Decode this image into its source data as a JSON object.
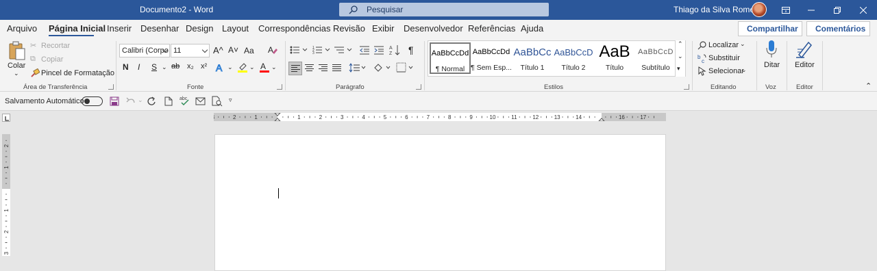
{
  "title_bar": {
    "document_title": "Documento2  -  Word",
    "search_placeholder": "Pesquisar",
    "user_name": "Thiago da Silva Romeiro"
  },
  "tabs": [
    "Arquivo",
    "Página Inicial",
    "Inserir",
    "Desenhar",
    "Design",
    "Layout",
    "Correspondências",
    "Revisão",
    "Exibir",
    "Desenvolvedor",
    "Referências",
    "Ajuda"
  ],
  "active_tab": "Página Inicial",
  "share": {
    "compartilhar": "Compartilhar",
    "comentarios": "Comentários"
  },
  "clipboard": {
    "paste": "Colar",
    "cut": "Recortar",
    "copy": "Copiar",
    "format_painter": "Pincel de Formatação",
    "group_label": "Área de Transferência"
  },
  "font": {
    "name": "Calibri (Corpo",
    "size": "11",
    "group_label": "Fonte",
    "grow": "A^",
    "shrink": "A˅",
    "case": "Aa",
    "bold": "N",
    "italic": "I",
    "underline": "S",
    "strike": "ab",
    "sub": "x₂",
    "sup": "x²"
  },
  "paragraph": {
    "group_label": "Parágrafo"
  },
  "styles": {
    "group_label": "Estilos",
    "items": [
      {
        "preview": "AaBbCcDd",
        "name": "¶ Normal"
      },
      {
        "preview": "AaBbCcDd",
        "name": "¶ Sem Esp..."
      },
      {
        "preview": "AaBbCc",
        "name": "Título 1"
      },
      {
        "preview": "AaBbCcD",
        "name": "Título 2"
      },
      {
        "preview": "AaB",
        "name": "Título"
      },
      {
        "preview": "AaBbCcD",
        "name": "Subtítulo"
      }
    ]
  },
  "editing": {
    "find": "Localizar",
    "replace": "Substituir",
    "select": "Selecionar",
    "group_label": "Editando"
  },
  "voice": {
    "dictate": "Ditar",
    "group_label": "Voz"
  },
  "editor": {
    "label": "Editor",
    "group_label": "Editor"
  },
  "qat": {
    "autosave": "Salvamento Automático"
  },
  "ruler": {
    "h_numbers": [
      "3",
      "2",
      "1",
      "1",
      "2",
      "3",
      "4",
      "5",
      "6",
      "7",
      "8",
      "9",
      "10",
      "11",
      "12",
      "13",
      "14",
      "16",
      "17"
    ],
    "v_numbers": [
      "2",
      "1",
      "1",
      "2",
      "3"
    ]
  },
  "colors": {
    "accent": "#2b579a",
    "highlight": "#ffff00",
    "font_color": "#ff0000"
  }
}
